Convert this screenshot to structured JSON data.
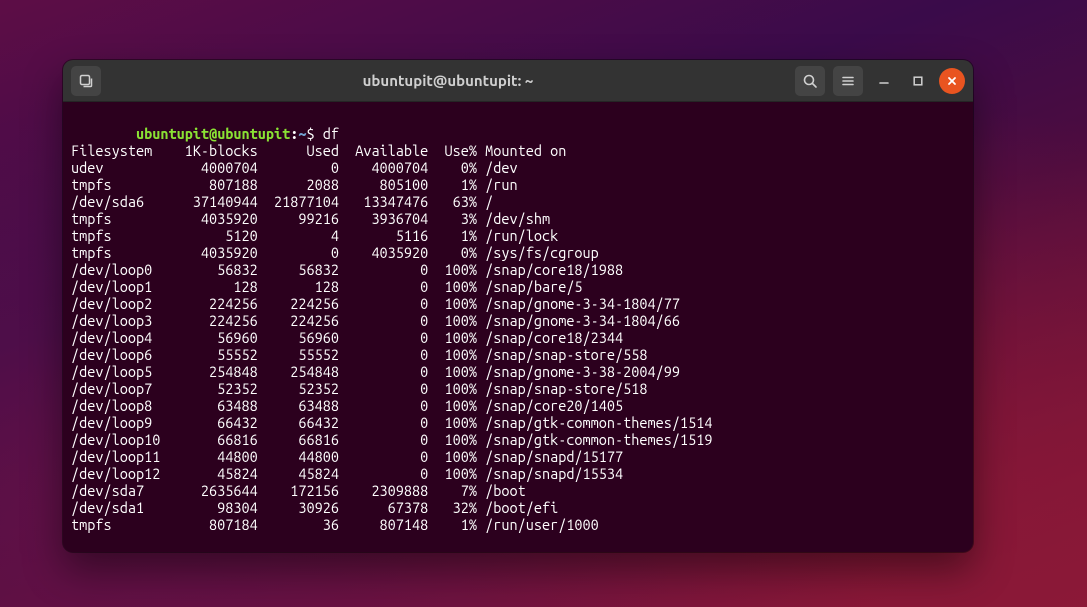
{
  "window": {
    "title": "ubuntupit@ubuntupit: ~"
  },
  "prompt": {
    "user": "ubuntupit",
    "host": "ubuntupit",
    "path": "~",
    "symbol": "$",
    "command": "df"
  },
  "df": {
    "headers": [
      "Filesystem",
      "1K-blocks",
      "Used",
      "Available",
      "Use%",
      "Mounted on"
    ],
    "rows": [
      {
        "fs": "udev",
        "blocks": "4000704",
        "used": "0",
        "avail": "4000704",
        "usep": "0%",
        "mount": "/dev"
      },
      {
        "fs": "tmpfs",
        "blocks": "807188",
        "used": "2088",
        "avail": "805100",
        "usep": "1%",
        "mount": "/run"
      },
      {
        "fs": "/dev/sda6",
        "blocks": "37140944",
        "used": "21877104",
        "avail": "13347476",
        "usep": "63%",
        "mount": "/"
      },
      {
        "fs": "tmpfs",
        "blocks": "4035920",
        "used": "99216",
        "avail": "3936704",
        "usep": "3%",
        "mount": "/dev/shm"
      },
      {
        "fs": "tmpfs",
        "blocks": "5120",
        "used": "4",
        "avail": "5116",
        "usep": "1%",
        "mount": "/run/lock"
      },
      {
        "fs": "tmpfs",
        "blocks": "4035920",
        "used": "0",
        "avail": "4035920",
        "usep": "0%",
        "mount": "/sys/fs/cgroup"
      },
      {
        "fs": "/dev/loop0",
        "blocks": "56832",
        "used": "56832",
        "avail": "0",
        "usep": "100%",
        "mount": "/snap/core18/1988"
      },
      {
        "fs": "/dev/loop1",
        "blocks": "128",
        "used": "128",
        "avail": "0",
        "usep": "100%",
        "mount": "/snap/bare/5"
      },
      {
        "fs": "/dev/loop2",
        "blocks": "224256",
        "used": "224256",
        "avail": "0",
        "usep": "100%",
        "mount": "/snap/gnome-3-34-1804/77"
      },
      {
        "fs": "/dev/loop3",
        "blocks": "224256",
        "used": "224256",
        "avail": "0",
        "usep": "100%",
        "mount": "/snap/gnome-3-34-1804/66"
      },
      {
        "fs": "/dev/loop4",
        "blocks": "56960",
        "used": "56960",
        "avail": "0",
        "usep": "100%",
        "mount": "/snap/core18/2344"
      },
      {
        "fs": "/dev/loop6",
        "blocks": "55552",
        "used": "55552",
        "avail": "0",
        "usep": "100%",
        "mount": "/snap/snap-store/558"
      },
      {
        "fs": "/dev/loop5",
        "blocks": "254848",
        "used": "254848",
        "avail": "0",
        "usep": "100%",
        "mount": "/snap/gnome-3-38-2004/99"
      },
      {
        "fs": "/dev/loop7",
        "blocks": "52352",
        "used": "52352",
        "avail": "0",
        "usep": "100%",
        "mount": "/snap/snap-store/518"
      },
      {
        "fs": "/dev/loop8",
        "blocks": "63488",
        "used": "63488",
        "avail": "0",
        "usep": "100%",
        "mount": "/snap/core20/1405"
      },
      {
        "fs": "/dev/loop9",
        "blocks": "66432",
        "used": "66432",
        "avail": "0",
        "usep": "100%",
        "mount": "/snap/gtk-common-themes/1514"
      },
      {
        "fs": "/dev/loop10",
        "blocks": "66816",
        "used": "66816",
        "avail": "0",
        "usep": "100%",
        "mount": "/snap/gtk-common-themes/1519"
      },
      {
        "fs": "/dev/loop11",
        "blocks": "44800",
        "used": "44800",
        "avail": "0",
        "usep": "100%",
        "mount": "/snap/snapd/15177"
      },
      {
        "fs": "/dev/loop12",
        "blocks": "45824",
        "used": "45824",
        "avail": "0",
        "usep": "100%",
        "mount": "/snap/snapd/15534"
      },
      {
        "fs": "/dev/sda7",
        "blocks": "2635644",
        "used": "172156",
        "avail": "2309888",
        "usep": "7%",
        "mount": "/boot"
      },
      {
        "fs": "/dev/sda1",
        "blocks": "98304",
        "used": "30926",
        "avail": "67378",
        "usep": "32%",
        "mount": "/boot/efi"
      },
      {
        "fs": "tmpfs",
        "blocks": "807184",
        "used": "36",
        "avail": "807148",
        "usep": "1%",
        "mount": "/run/user/1000"
      }
    ]
  },
  "cols": {
    "fs": 14,
    "blocks": 9,
    "used": 9,
    "avail": 10,
    "usep": 5
  }
}
